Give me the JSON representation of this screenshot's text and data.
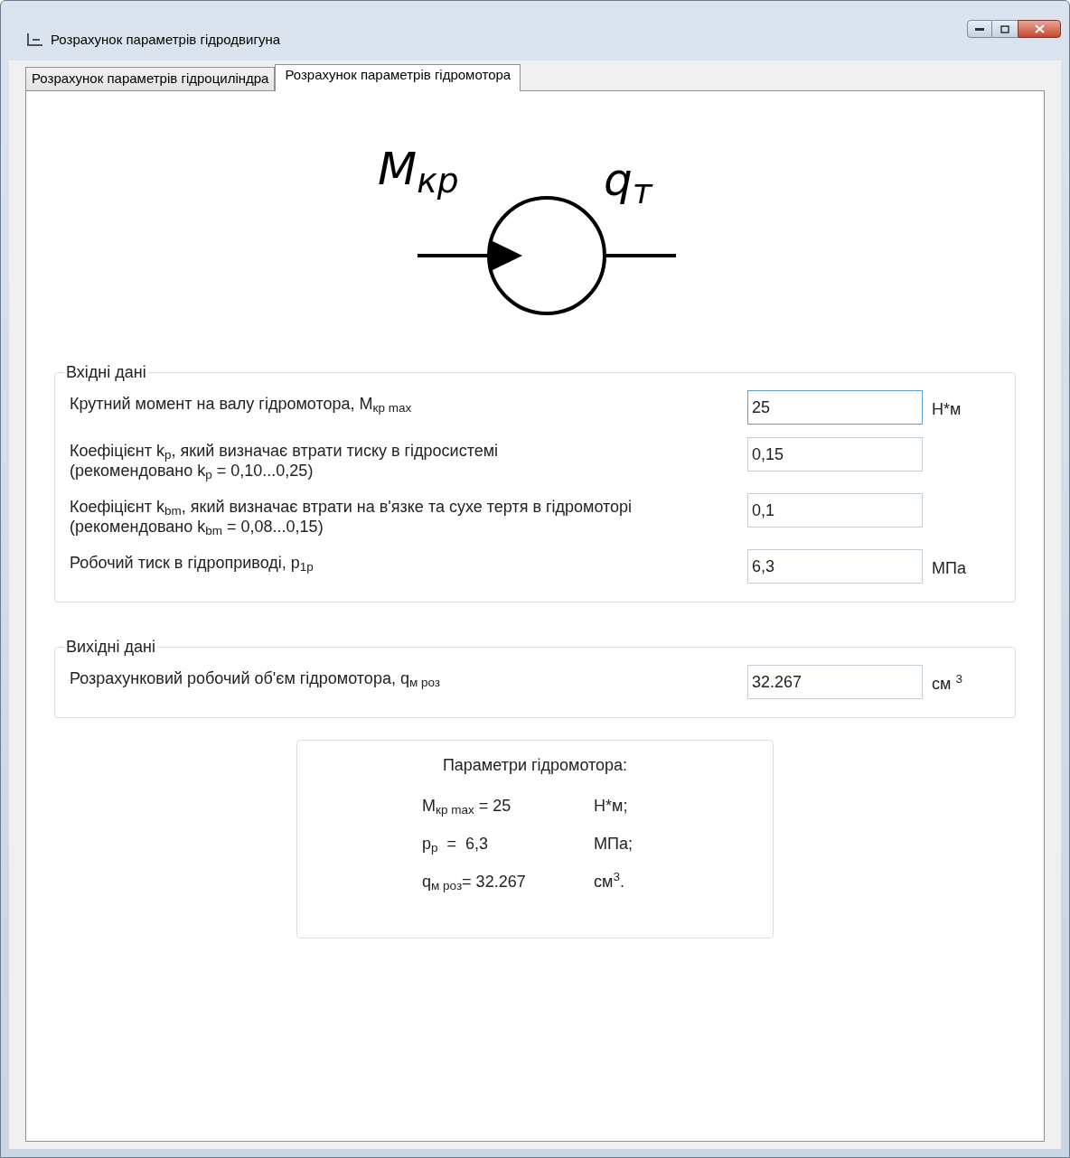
{
  "window": {
    "title": "Розрахунок параметрів гідродвигуна"
  },
  "tabs": [
    {
      "label": "Розрахунок параметрів гідроциліндра",
      "selected": false
    },
    {
      "label": "Розрахунок параметрів гідромотора",
      "selected": true
    }
  ],
  "diagram": {
    "input_label": "M$_{кр}$",
    "output_label": "q$_{т}$"
  },
  "input_group": {
    "title": "Вхідні дані",
    "fields": [
      {
        "label_lines": [
          "Крутний момент на валу гідромотора, M$_{кр max}$"
        ],
        "value": "25",
        "unit": "Н*м",
        "focused": true
      },
      {
        "label_lines": [
          "Коефіцієнт k$_{p}$, який визначає втрати тиску в гідросистемі",
          "(рекомендовано k$_{p}$ = 0,10...0,25)"
        ],
        "value": "0,15",
        "focused": false
      },
      {
        "label_lines": [
          "Коефіцієнт k$_{bm}$, який визначає втрати на в'язке та сухе тертя в гідромоторі",
          "(рекомендовано k$_{bm}$ = 0,08...0,15)"
        ],
        "value": "0,1",
        "focused": false
      },
      {
        "label_lines": [
          "Робочий тиск в гідроприводі, p$_{1p}$"
        ],
        "value": "6,3",
        "unit": "МПа",
        "focused": false
      }
    ]
  },
  "output_group": {
    "title": "Вихідні дані",
    "fields": [
      {
        "label_lines": [
          "Розрахунковий робочий об'єм гідромотора, q$_{м роз}$"
        ],
        "value": "32.267",
        "unit": "см $^{3}$",
        "focused": false
      }
    ]
  },
  "summary": {
    "title": "Параметри гідромотора:",
    "rows": [
      {
        "expression": "M$_{кр max}$ = 25",
        "unit": "Н*м;"
      },
      {
        "expression": "p$_{p}$  =  6,3",
        "unit": "МПа;"
      },
      {
        "expression": "q$_{м роз}$= 32.267",
        "unit": "см$^{3}$."
      }
    ]
  }
}
